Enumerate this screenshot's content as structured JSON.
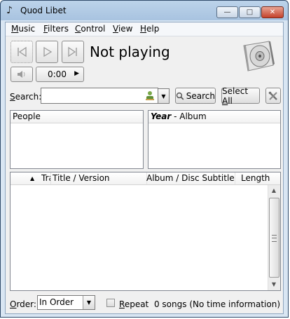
{
  "window": {
    "title": "Quod Libet"
  },
  "menu": {
    "items": [
      {
        "label": "Music",
        "underline": "M",
        "rest": "usic"
      },
      {
        "label": "Filters",
        "underline": "F",
        "rest": "ilters"
      },
      {
        "label": "Control",
        "underline": "C",
        "rest": "ontrol"
      },
      {
        "label": "View",
        "underline": "V",
        "rest": "iew"
      },
      {
        "label": "Help",
        "underline": "H",
        "rest": "elp"
      }
    ]
  },
  "player": {
    "status": "Not playing",
    "position": "0:00"
  },
  "search": {
    "label_underline": "S",
    "label_rest": "earch:",
    "value": "",
    "button_label": "Search",
    "select_all_prefix": "Select ",
    "select_all_underline": "A",
    "select_all_rest": "ll"
  },
  "panes": {
    "people_header": "People",
    "album_header_bold": "Year",
    "album_header_rest": " - Album"
  },
  "songlist": {
    "columns": [
      "Track",
      "Title / Version",
      "Album / Disc Subtitle",
      "Length"
    ]
  },
  "footer": {
    "order_label_underline": "O",
    "order_label_rest": "rder:",
    "order_value": "In Order",
    "repeat_underline": "R",
    "repeat_rest": "epeat",
    "repeat_checked": false,
    "status": "0 songs (No time information)"
  }
}
